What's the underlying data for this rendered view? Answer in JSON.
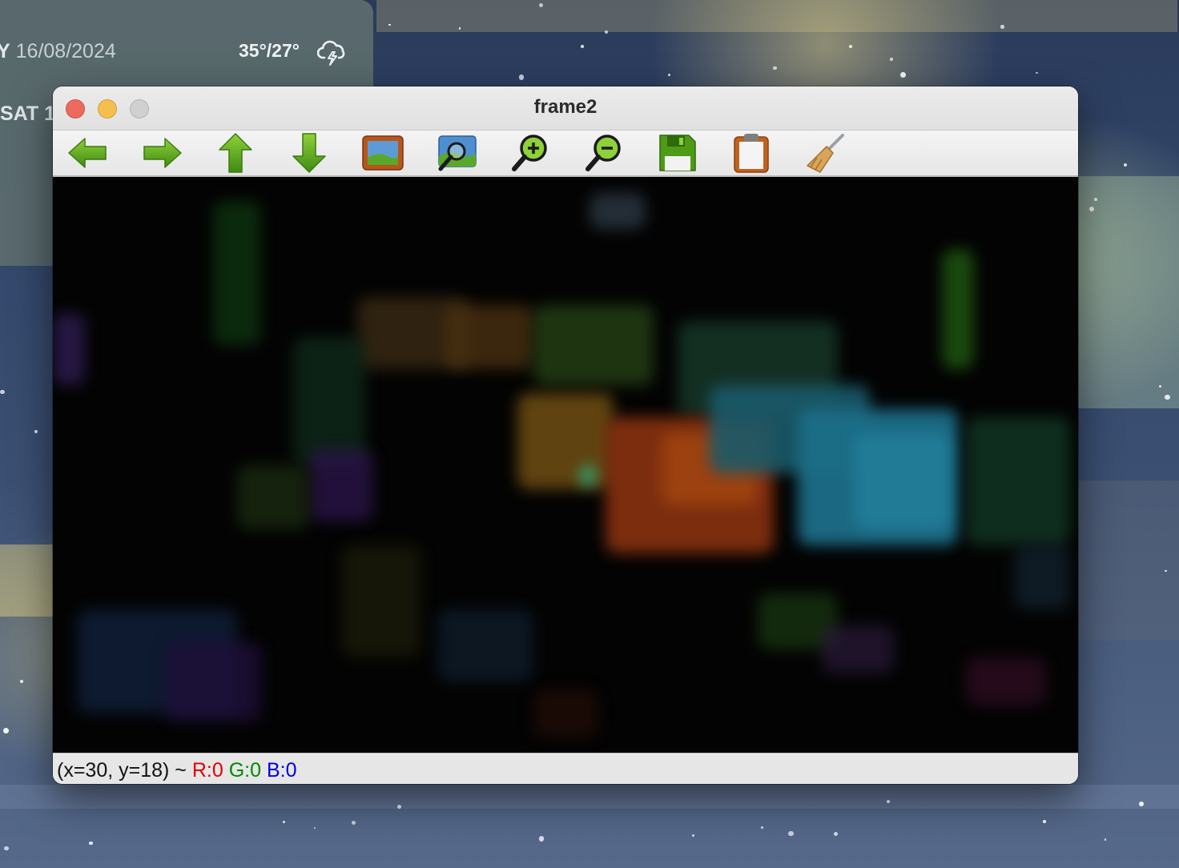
{
  "widget": {
    "day_prefix": "Y",
    "date": "16/08/2024",
    "temp": "35°/27°",
    "weather_icon": "thunder-cloud-icon",
    "next_row": "SAT 1"
  },
  "window": {
    "title": "frame2",
    "controls": [
      "close",
      "minimize",
      "maximize"
    ]
  },
  "toolbar": {
    "buttons": [
      {
        "name": "back",
        "icon": "arrow-left-icon"
      },
      {
        "name": "forward",
        "icon": "arrow-right-icon"
      },
      {
        "name": "up",
        "icon": "arrow-up-icon"
      },
      {
        "name": "down",
        "icon": "arrow-down-icon"
      },
      {
        "name": "fit-image",
        "icon": "picture-icon"
      },
      {
        "name": "zoom-image",
        "icon": "zoom-picture-icon"
      },
      {
        "name": "zoom-in",
        "icon": "zoom-in-icon"
      },
      {
        "name": "zoom-out",
        "icon": "zoom-out-icon"
      },
      {
        "name": "save",
        "icon": "floppy-disk-icon"
      },
      {
        "name": "copy",
        "icon": "clipboard-icon"
      },
      {
        "name": "clear",
        "icon": "broom-icon"
      }
    ],
    "accent_color": "#5a9e1a"
  },
  "status": {
    "coords": "(x=30, y=18) ~",
    "r": "R:0",
    "g": "G:0",
    "b": "B:0",
    "colors": {
      "r": "#e00000",
      "g": "#008800",
      "b": "#0000e0"
    }
  }
}
